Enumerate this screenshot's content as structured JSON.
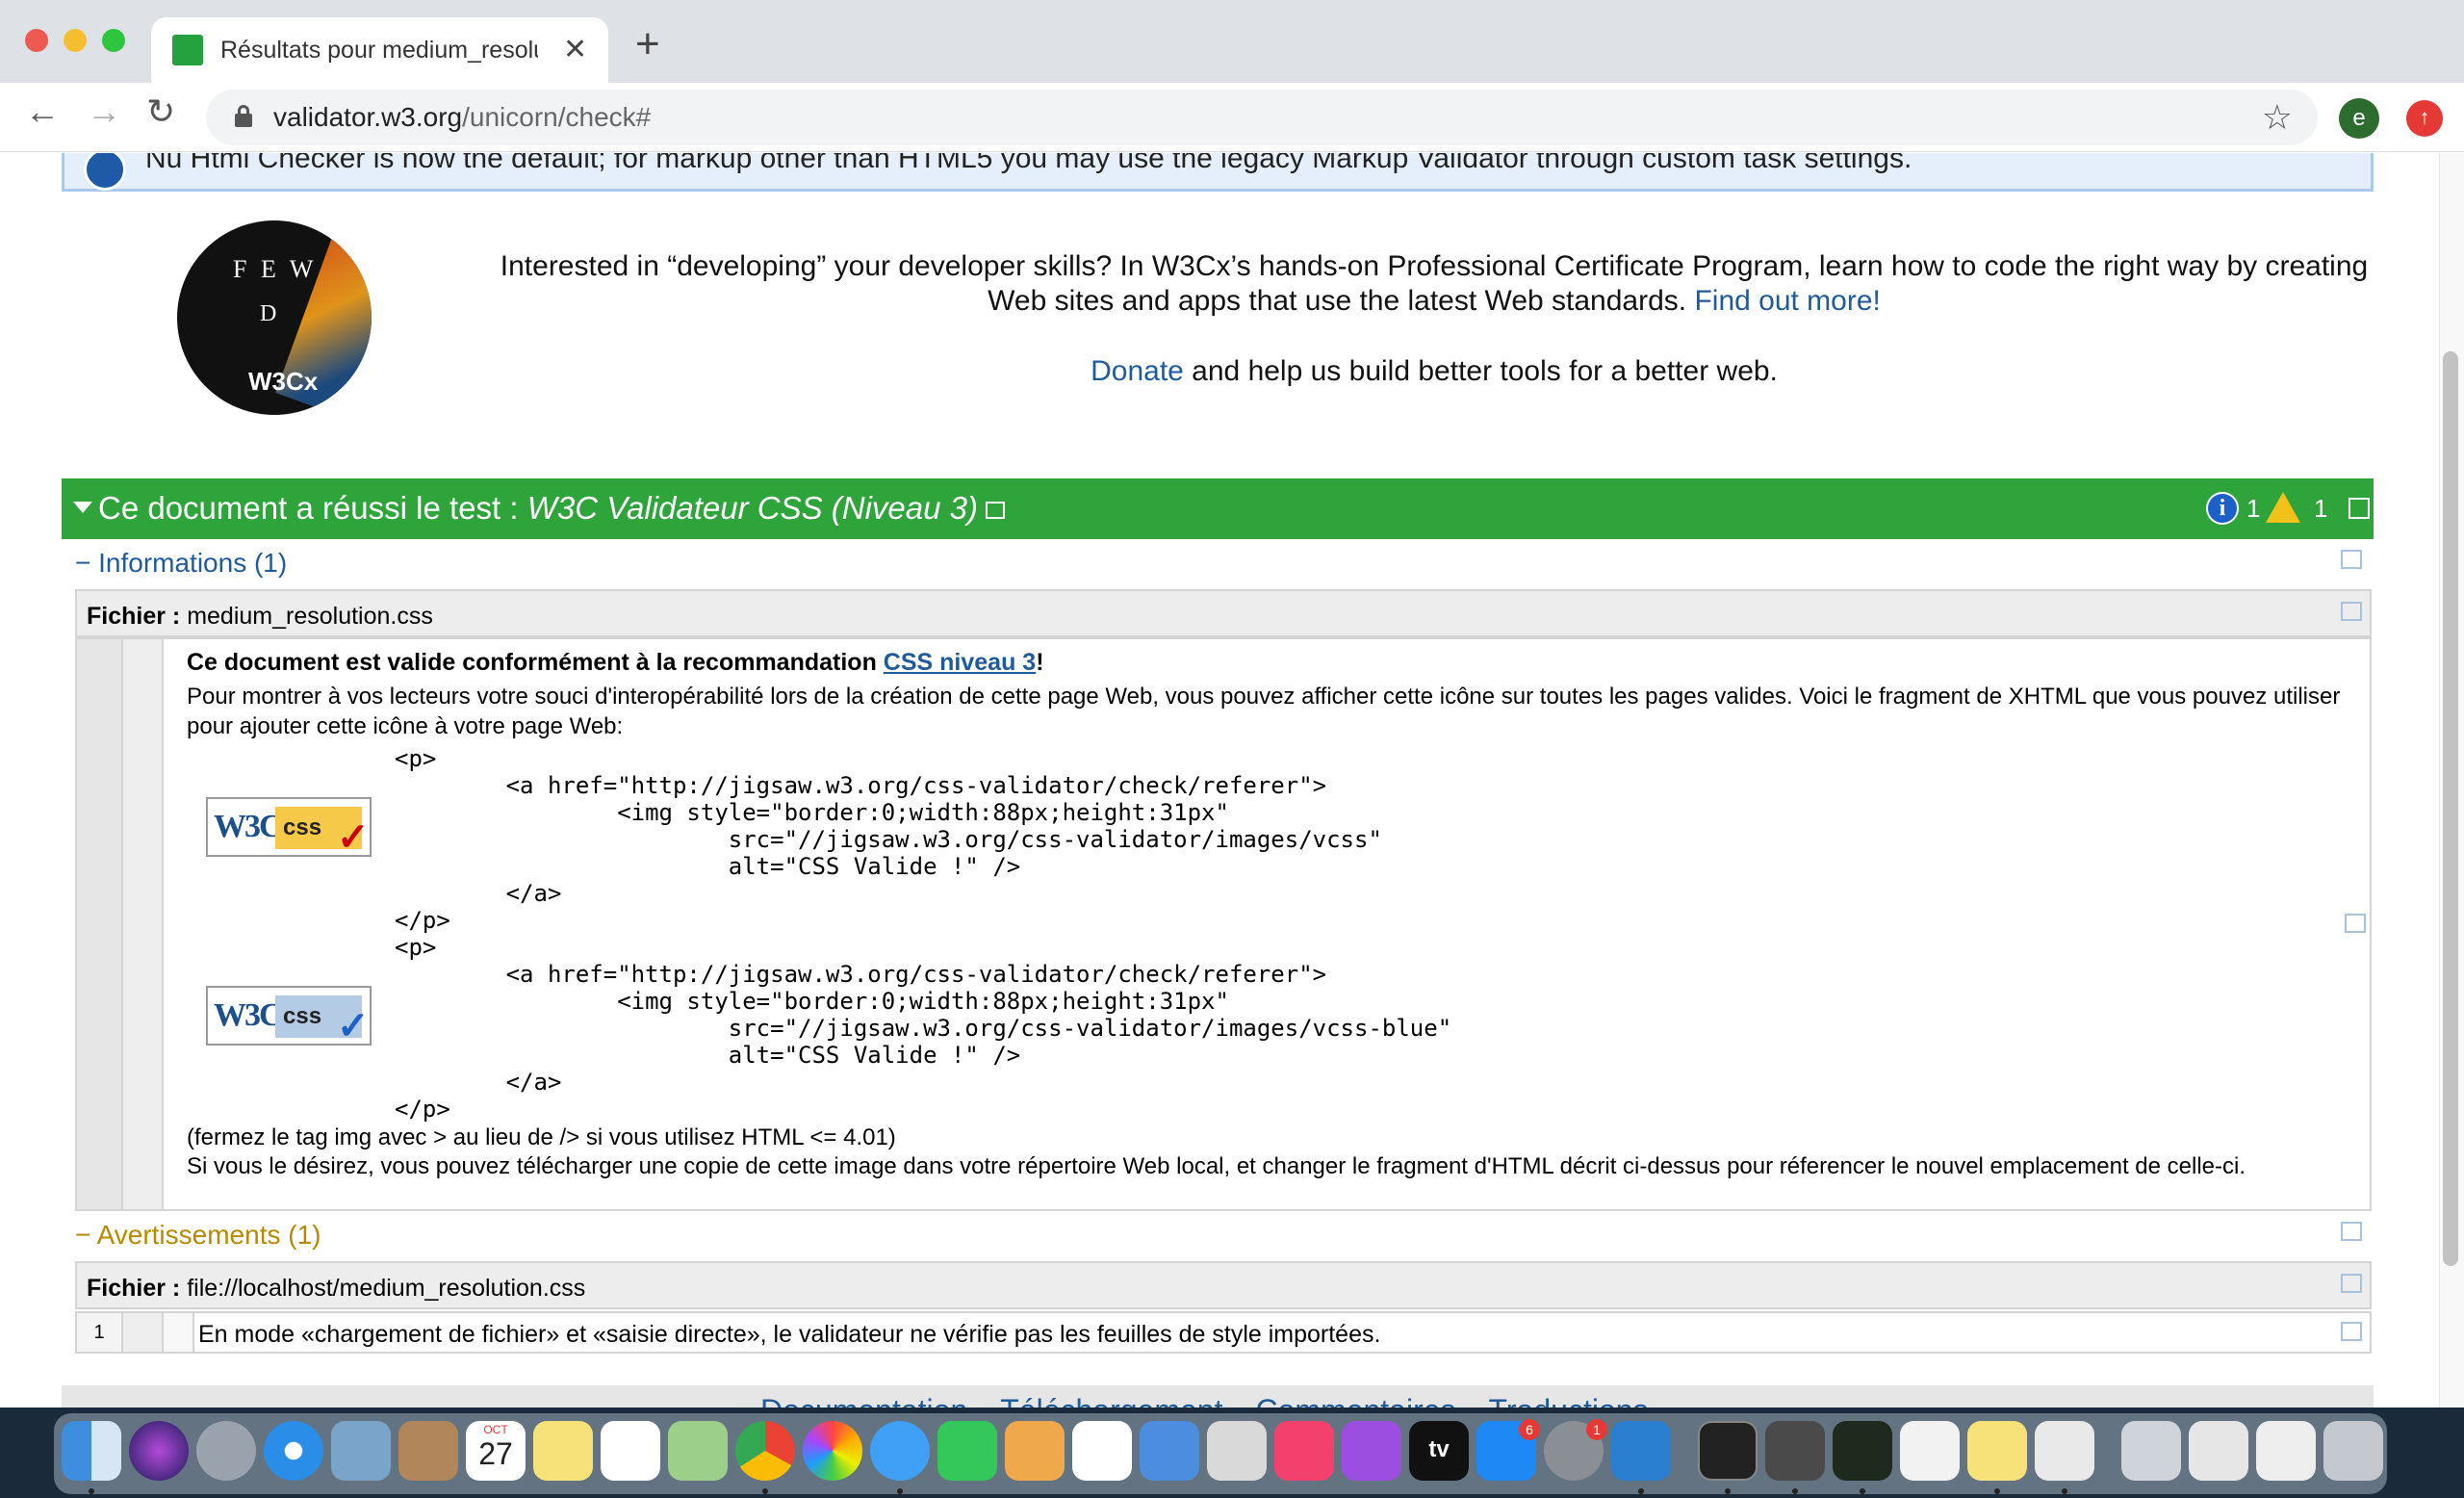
{
  "browser": {
    "tab_title": "Résultats pour medium_resolut",
    "url_host": "validator.w3.org",
    "url_path": "/unicorn/check#",
    "avatar_letter": "e"
  },
  "notice": {
    "text": "Nu Html Checker is now the default; for markup other than HTML5 you may use the legacy Markup Validator through custom task settings."
  },
  "logo": {
    "line1": "F E W",
    "line2": "D",
    "line3": "W3Cx"
  },
  "promo": {
    "text": "Interested in “developing” your developer skills? In W3Cx’s hands-on Professional Certificate Program, learn how to code the right way by creating Web sites and apps that use the latest Web standards.",
    "link": "Find out more!",
    "donate_link": "Donate",
    "donate_text": " and help us build better tools for a better web."
  },
  "result": {
    "prefix": "Ce document a réussi le test : ",
    "validator": "W3C Validateur CSS (Niveau 3)",
    "info_count": "1",
    "warning_count": "1"
  },
  "informations": {
    "header": "− Informations (1)",
    "file_label": "Fichier :",
    "file_name": " medium_resolution.css",
    "valid_prefix": "Ce document est valide conformément à la recommandation ",
    "valid_link": "CSS niveau 3",
    "valid_suffix": "!",
    "para1": "Pour montrer à vos lecteurs votre souci d'interopérabilité lors de la création de cette page Web, vous pouvez afficher cette icône sur toutes les pages valides. Voici le fragment de XHTML que vous pouvez utiliser pour ajouter cette icône à votre page Web:",
    "code1": "<p>\n        <a href=\"http://jigsaw.w3.org/css-validator/check/referer\">\n                <img style=\"border:0;width:88px;height:31px\"\n                        src=\"//jigsaw.w3.org/css-validator/images/vcss\"\n                        alt=\"CSS Valide !\" />\n        </a>\n</p>",
    "code2": "<p>\n        <a href=\"http://jigsaw.w3.org/css-validator/check/referer\">\n                <img style=\"border:0;width:88px;height:31px\"\n                        src=\"//jigsaw.w3.org/css-validator/images/vcss-blue\"\n                        alt=\"CSS Valide !\" />\n        </a>\n</p>",
    "badge_w3c": "W3C",
    "badge_css": "css",
    "note": "(fermez le tag img avec > au lieu de /> si vous utilisez HTML <= 4.01)",
    "para2": "Si vous le désirez, vous pouvez télécharger une copie de cette image dans votre répertoire Web local, et changer le fragment d'HTML décrit ci-dessus pour réferencer le nouvel emplacement de celle-ci."
  },
  "warnings": {
    "header": "− Avertissements (1)",
    "file_label": "Fichier :",
    "file_name": " file://localhost/medium_resolution.css",
    "line": "1",
    "message": "En mode «chargement de fichier» et «saisie directe», le validateur ne vérifie pas les feuilles de style importées."
  },
  "footer": {
    "links": [
      "Documentation",
      "Téléchargement",
      "Commentaires",
      "Traductions"
    ]
  },
  "dock": {
    "calendar_month": "OCT",
    "calendar_day": "27",
    "appstore_badge": "6",
    "settings_badge": "1",
    "tv_label": "tv"
  },
  "colors": {
    "pass_green": "#2ea43b",
    "link_blue": "#1f5b9a",
    "warning_amber": "#b58900"
  }
}
